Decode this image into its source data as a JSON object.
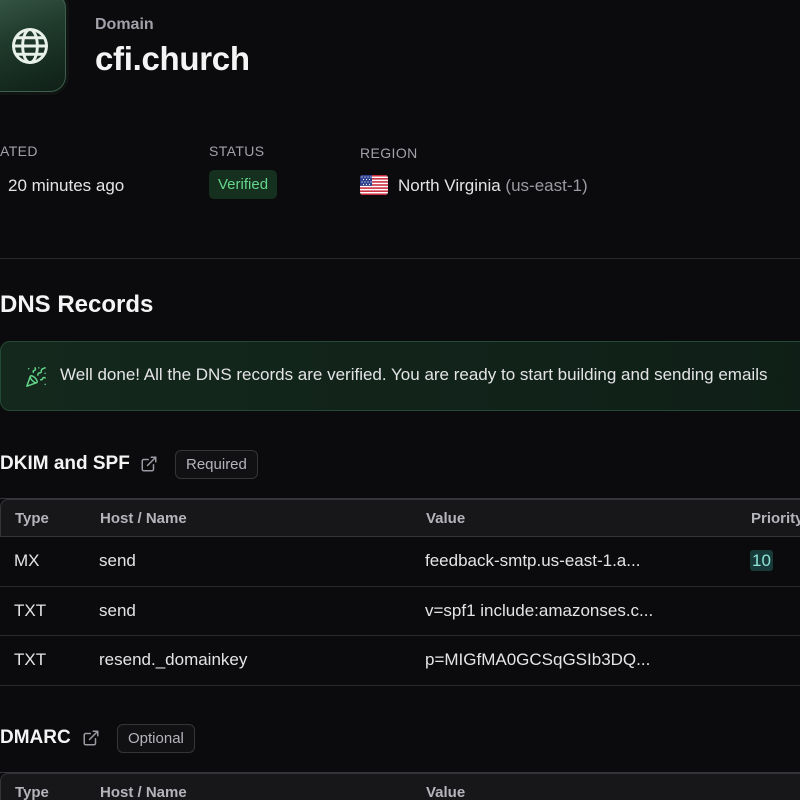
{
  "header": {
    "eyebrow": "Domain",
    "title": "cfi.church"
  },
  "meta": {
    "created_label": "ATED",
    "created_value": "20 minutes ago",
    "status_label": "STATUS",
    "status_value": "Verified",
    "region_label": "REGION",
    "region_name": "North Virginia",
    "region_code": "(us-east-1)"
  },
  "dns": {
    "title": "DNS Records",
    "alert_text": "Well done! All the DNS records are verified. You are ready to start building and sending emails"
  },
  "dkim_spf": {
    "title": "DKIM and SPF",
    "badge": "Required",
    "columns": [
      "Type",
      "Host / Name",
      "Value",
      "Priority"
    ],
    "rows": [
      {
        "type": "MX",
        "host": "send",
        "value": "feedback-smtp.us-east-1.a...",
        "priority": "10"
      },
      {
        "type": "TXT",
        "host": "send",
        "value": "v=spf1 include:amazonses.c...",
        "priority": ""
      },
      {
        "type": "TXT",
        "host": "resend._domainkey",
        "value": "p=MIGfMA0GCSqGSIb3DQ...",
        "priority": ""
      }
    ]
  },
  "dmarc": {
    "title": "DMARC",
    "badge": "Optional",
    "columns": [
      "Type",
      "Host / Name",
      "Value"
    ]
  },
  "colors": {
    "background": "#0b0b0d",
    "success": "#63d68a",
    "success_bg": "#16301f",
    "priority_bg": "#173a38",
    "priority_fg": "#8fe3d8"
  },
  "icons": {
    "domain": "globe-icon",
    "alert": "party-popper-icon",
    "external": "external-link-icon",
    "flag": "us-flag-icon"
  }
}
